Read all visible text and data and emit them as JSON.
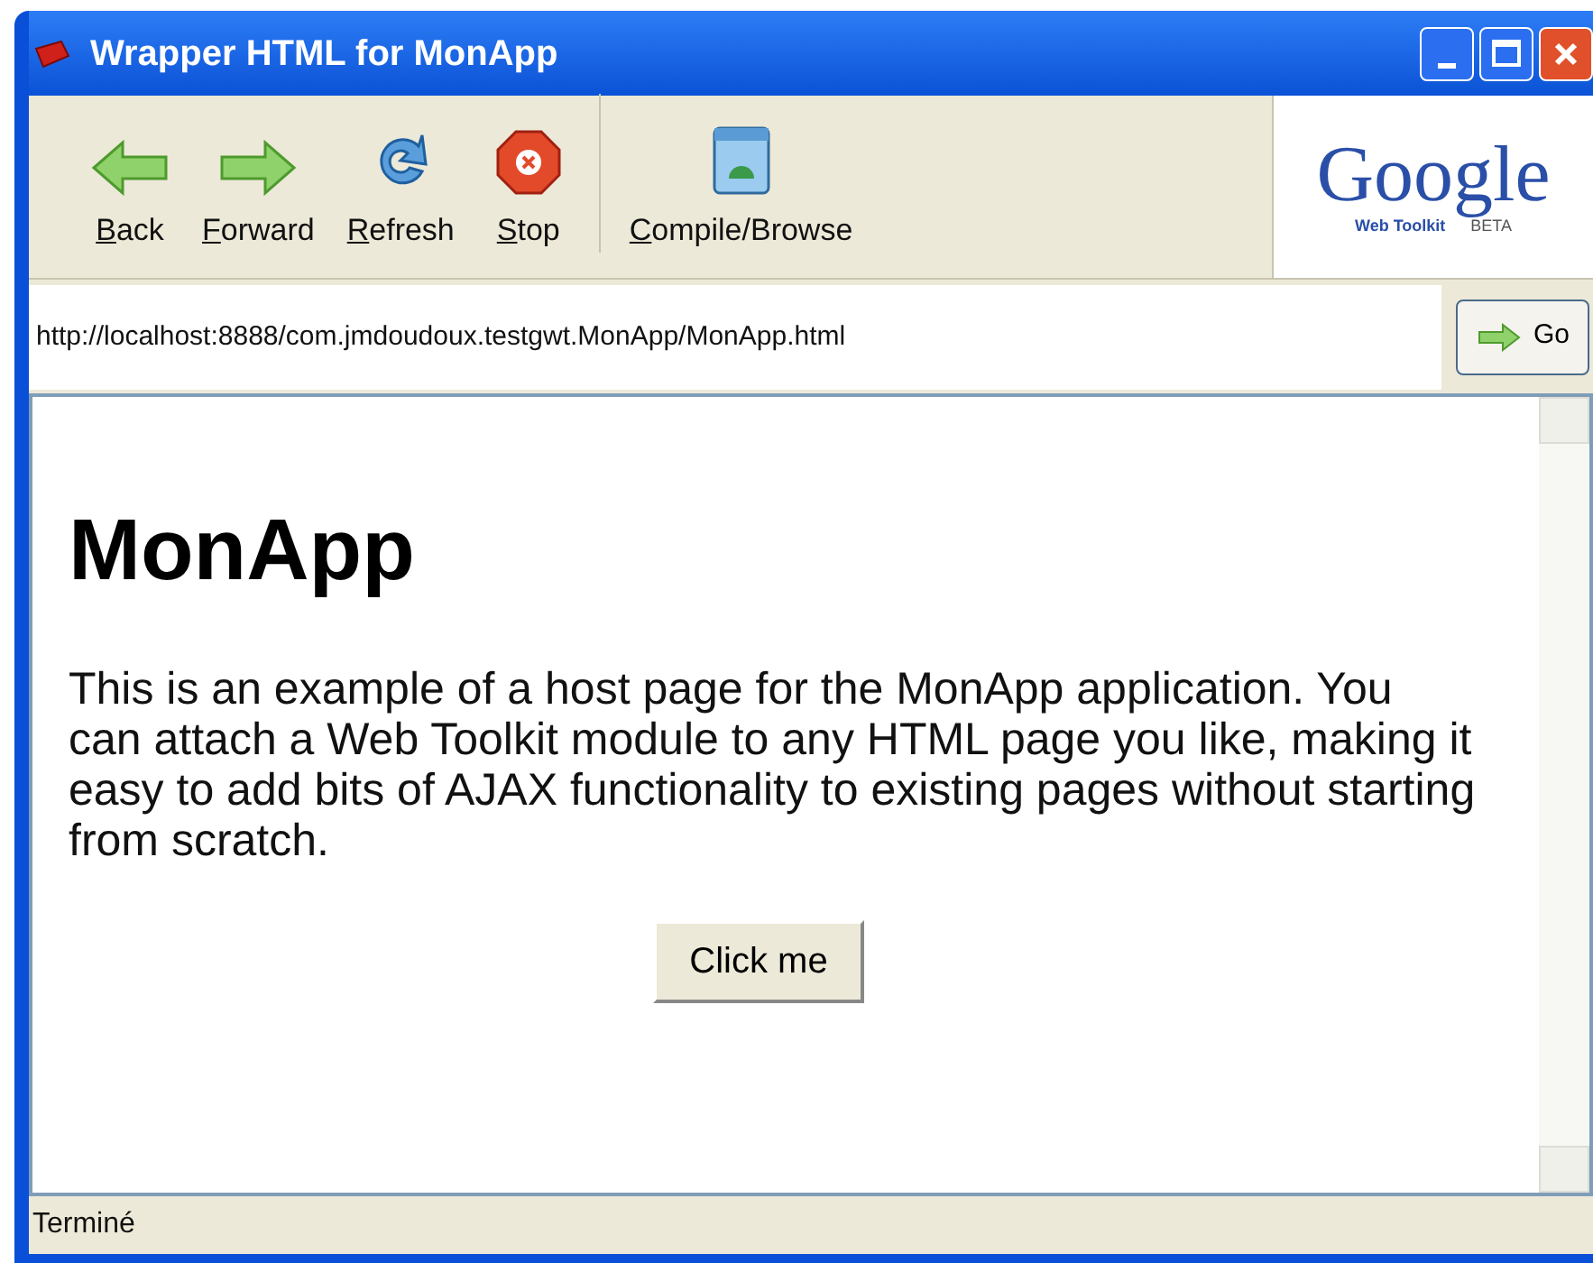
{
  "window": {
    "title": "Wrapper HTML for MonApp"
  },
  "toolbar": {
    "buttons": [
      {
        "kind": "back",
        "mnemonic": "B",
        "rest": "ack"
      },
      {
        "kind": "forward",
        "mnemonic": "F",
        "rest": "orward"
      },
      {
        "kind": "refresh",
        "mnemonic": "R",
        "rest": "efresh"
      },
      {
        "kind": "stop",
        "mnemonic": "S",
        "rest": "top"
      },
      {
        "kind": "compile",
        "mnemonic": "C",
        "rest": "ompile/Browse"
      }
    ],
    "logo": {
      "name": "Google",
      "sub": "Web Toolkit",
      "badge": "BETA"
    }
  },
  "address_bar": {
    "value": "http://localhost:8888/com.jmdoudoux.testgwt.MonApp/MonApp.html",
    "go_button": "Go"
  },
  "page": {
    "heading": "MonApp",
    "paragraph": "This is an example of a host page for the MonApp application. You can attach a Web Toolkit module to any HTML page you like, making it easy to add bits of AJAX functionality to existing pages without starting from scratch.",
    "button": "Click me"
  },
  "status_bar": "Terminé"
}
